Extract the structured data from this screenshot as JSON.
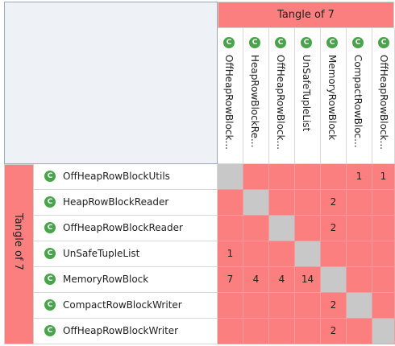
{
  "matrix": {
    "tangle_label": "Tangle of 7",
    "class_icon_glyph": "C",
    "class_icon_color": "#48a448",
    "tangle_color": "#fb7f7f",
    "diagonal_color": "#c8c8c8",
    "columns": [
      "OffHeapRowBlock...",
      "HeapRowBlockRe...",
      "OffHeapRowBlock...",
      "UnSafeTupleList",
      "MemoryRowBlock",
      "CompactRowBloc...",
      "OffHeapRowBlock..."
    ],
    "rows": [
      "OffHeapRowBlockUtils",
      "HeapRowBlockReader",
      "OffHeapRowBlockReader",
      "UnSafeTupleList",
      "MemoryRowBlock",
      "CompactRowBlockWriter",
      "OffHeapRowBlockWriter"
    ],
    "cells": [
      [
        "",
        "",
        "",
        "",
        "",
        "1",
        "1"
      ],
      [
        "",
        "",
        "",
        "",
        "2",
        "",
        ""
      ],
      [
        "",
        "",
        "",
        "",
        "2",
        "",
        ""
      ],
      [
        "1",
        "",
        "",
        "",
        "",
        "",
        ""
      ],
      [
        "7",
        "4",
        "4",
        "14",
        "",
        "",
        ""
      ],
      [
        "",
        "",
        "",
        "",
        "2",
        "",
        ""
      ],
      [
        "",
        "",
        "",
        "",
        "2",
        "",
        ""
      ]
    ]
  }
}
